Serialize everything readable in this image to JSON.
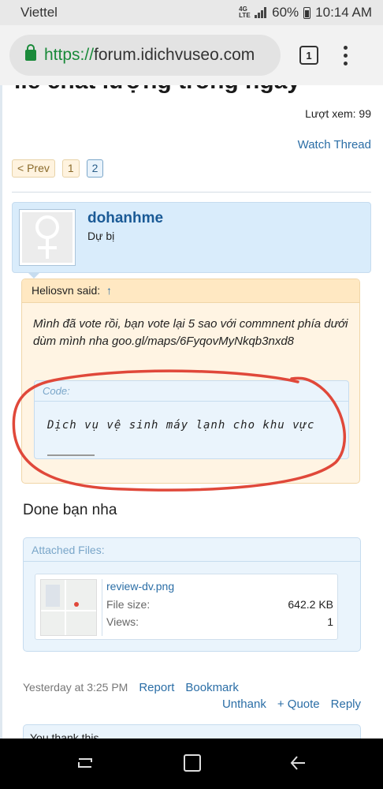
{
  "status_bar": {
    "carrier": "Viettel",
    "network_type": "4G LTE",
    "battery": "60%",
    "time": "10:14 AM"
  },
  "browser": {
    "url_scheme": "https://",
    "url_host": "forum.idichvuseo.com",
    "tab_count": "1"
  },
  "thread": {
    "title_fragment": "ile chất lượng trong ngày",
    "views": "Lượt xem: 99",
    "watch": "Watch Thread",
    "pager": {
      "prev": "< Prev",
      "pages": [
        "1",
        "2"
      ],
      "current": "2"
    }
  },
  "post": {
    "username": "dohanhme",
    "user_title": "Dự bị",
    "quote": {
      "author_said": "Heliosvn said:",
      "arrow": "↑",
      "text": "Mình đã vote rồi, bạn vote lại 5 sao với commnent phía dưới dùm mình nha goo.gl/maps/6FyqovMyNkqb3nxd8",
      "code_label": "Code:",
      "code_text": "Dịch vụ vệ sinh máy lạnh cho khu vực"
    },
    "message": "Done bạn nha",
    "attachments": {
      "header": "Attached Files:",
      "file": {
        "name": "review-dv.png",
        "size_label": "File size:",
        "size": "642.2 KB",
        "views_label": "Views:",
        "views": "1"
      }
    },
    "timestamp": "Yesterday at 3:25 PM",
    "report": "Report",
    "bookmark": "Bookmark",
    "actions": {
      "unthank": "Unthank",
      "quote": "+ Quote",
      "reply": "Reply"
    },
    "thanks_text": "You thank this."
  },
  "colors": {
    "link": "#2b6ea6",
    "annotation": "#e0483a",
    "quote_bg": "#fff4e3",
    "user_bar_bg": "#d9ecfb"
  }
}
